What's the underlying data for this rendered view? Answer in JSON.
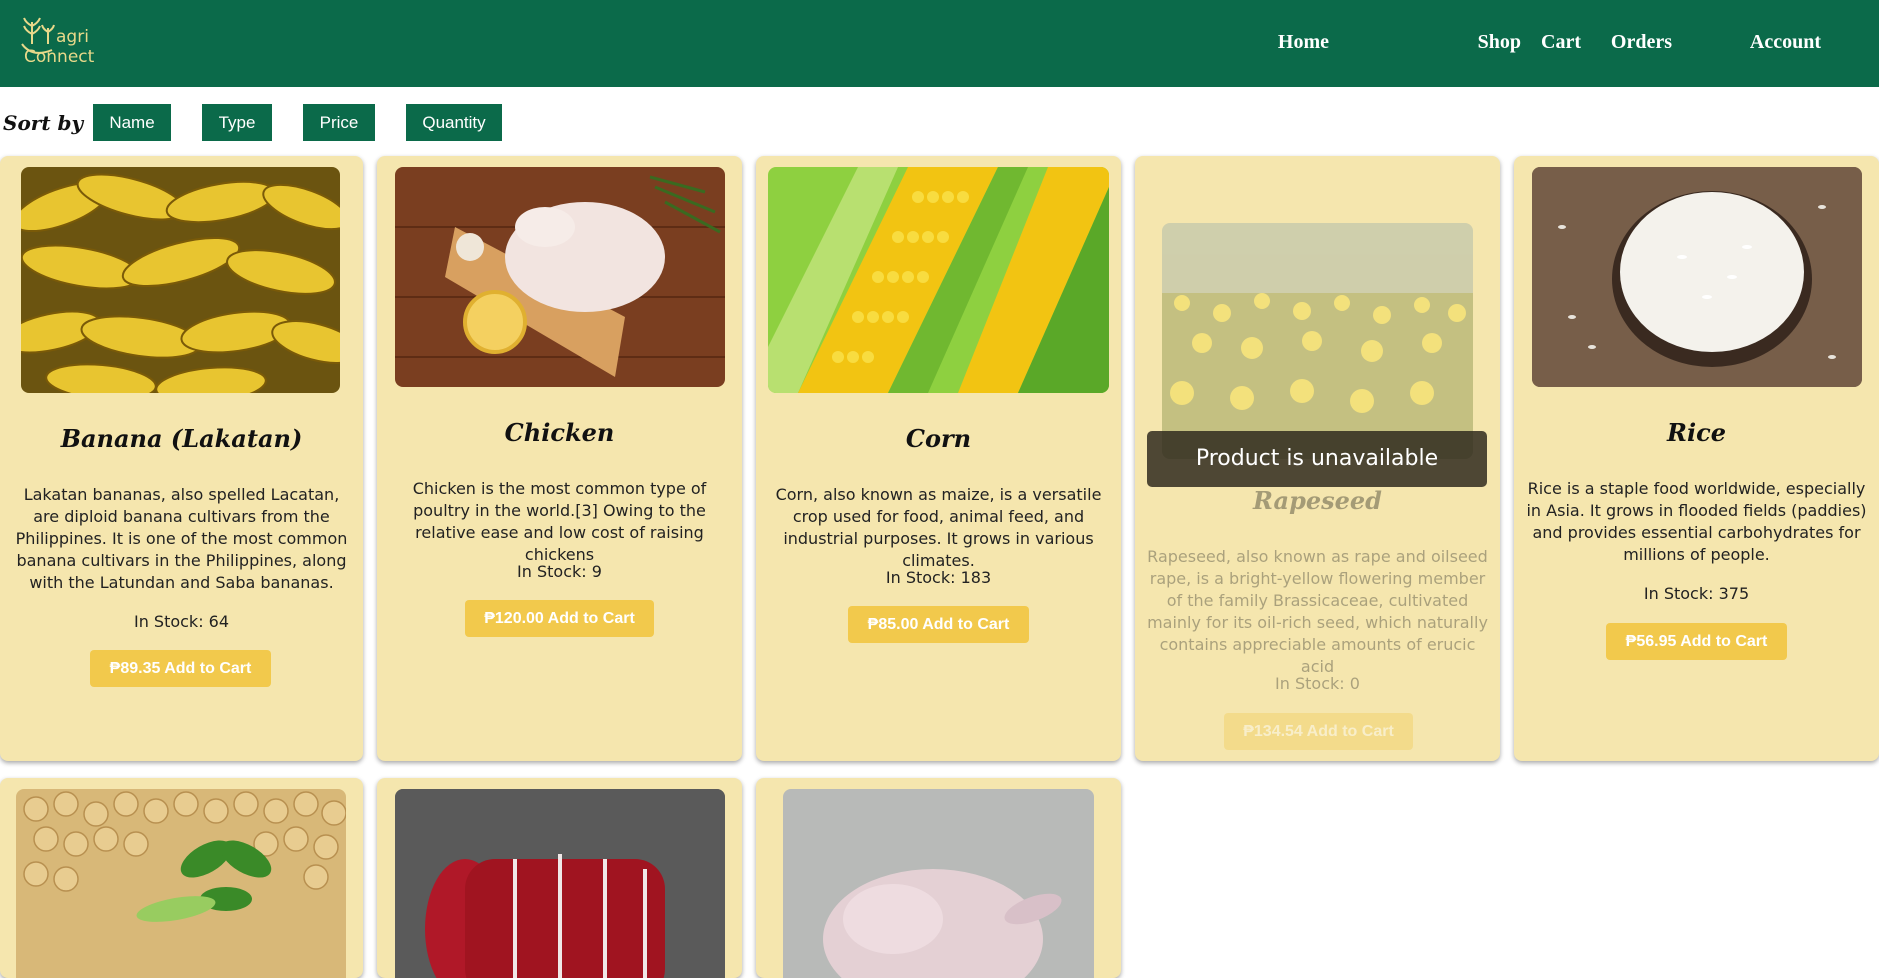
{
  "header": {
    "logo_text_top": "agri",
    "logo_text_bottom": "Connect",
    "nav": [
      "Home",
      "Shop",
      "Cart",
      "Orders",
      "Account"
    ]
  },
  "sort": {
    "label": "Sort by",
    "options": [
      "Name",
      "Type",
      "Price",
      "Quantity"
    ]
  },
  "products": [
    {
      "name": "Banana (Lakatan)",
      "description": "Lakatan bananas, also spelled Lacatan, are diploid banana cultivars from the Philippines. It is one of the most common banana cultivars in the Philippines, along with the Latundan and Saba bananas.",
      "stock": "In Stock: 64",
      "button": "₱89.35 Add to Cart"
    },
    {
      "name": "Chicken",
      "description": "Chicken is the most common type of poultry in the world.[3] Owing to the relative ease and low cost of raising chickens",
      "stock": "In Stock: 9",
      "button": "₱120.00 Add to Cart"
    },
    {
      "name": "Corn",
      "description": "Corn, also known as maize, is a versatile crop used for food, animal feed, and industrial purposes. It grows in various climates.",
      "stock": "In Stock: 183",
      "button": "₱85.00 Add to Cart"
    },
    {
      "name": "Rapeseed",
      "description": "Rapeseed, also known as rape and oilseed rape, is a bright-yellow flowering member of the family Brassicaceae, cultivated mainly for its oil-rich seed, which naturally contains appreciable amounts of erucic acid",
      "stock": "In Stock: 0",
      "button": "₱134.54 Add to Cart",
      "unavailable_text": "Product is unavailable"
    },
    {
      "name": "Rice",
      "description": "Rice is a staple food worldwide, especially in Asia. It grows in flooded fields (paddies) and provides essential carbohydrates for millions of people.",
      "stock": "In Stock: 375",
      "button": "₱56.95 Add to Cart"
    }
  ],
  "colors": {
    "header_bg": "#0b6a4a",
    "card_bg": "#f5e6ae",
    "button_bg": "#f2c94c"
  }
}
